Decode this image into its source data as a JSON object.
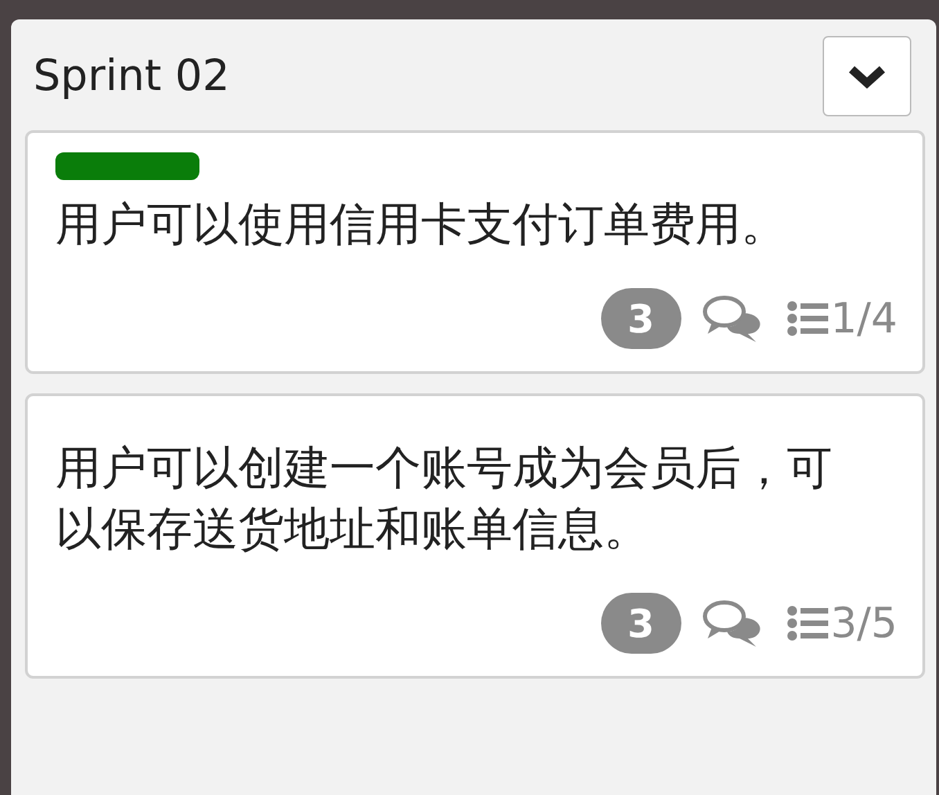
{
  "column": {
    "title": "Sprint 02",
    "expanded": true
  },
  "cards": [
    {
      "color": "#0a7d0a",
      "text": "用户可以使用信用卡支付订单费用。",
      "points": "3",
      "checklist": "1/4"
    },
    {
      "text": "用户可以创建一个账号成为会员后，可以保存送货地址和账单信息。",
      "points": "3",
      "checklist": "3/5"
    }
  ]
}
